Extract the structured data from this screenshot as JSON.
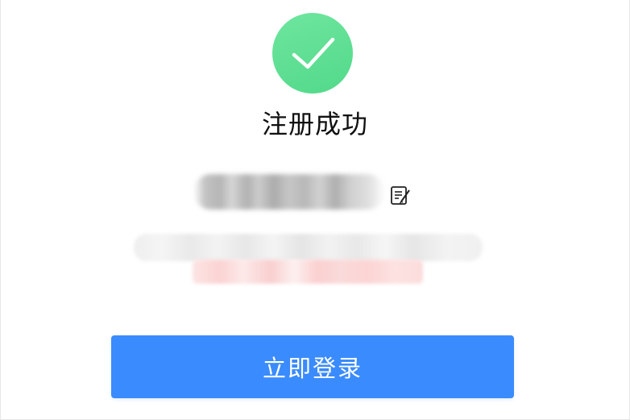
{
  "success": {
    "icon": "check-circle-icon",
    "color": "#5cdf93",
    "title": "注册成功"
  },
  "account": {
    "value_obscured": true,
    "edit_icon": "edit-note-icon"
  },
  "notice": {
    "obscured": true,
    "warning_color": "#fbd3d3"
  },
  "actions": {
    "login_label": "立即登录",
    "login_color": "#3a8bfd"
  }
}
